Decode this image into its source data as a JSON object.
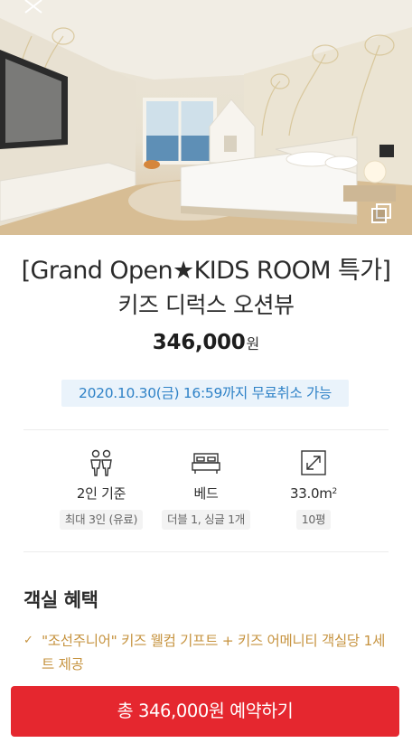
{
  "hero": {
    "image_alt": "",
    "close_icon": "close-icon",
    "gallery_icon": "gallery-icon"
  },
  "room": {
    "title": "[Grand Open★KIDS ROOM 특가]",
    "name": "키즈 디럭스 오션뷰",
    "price_amount": "346,000",
    "price_unit": "원",
    "cancel_notice": "2020.10.30(금) 16:59까지 무료취소 가능"
  },
  "specs": [
    {
      "icon": "guests-icon",
      "label": "2인 기준",
      "detail": "최대 3인 (유료)"
    },
    {
      "icon": "bed-icon",
      "label": "베드",
      "detail": "더블 1, 싱글 1개"
    },
    {
      "icon": "room-size-icon",
      "label": "33.0m",
      "label_sup": "2",
      "detail": "10평"
    }
  ],
  "benefits": {
    "title": "객실 혜택",
    "items": [
      "\"조선주니어\" 키즈 웰컴 기프트 + 키즈 어메니티 객실당 1세트 제공"
    ]
  },
  "cta": {
    "label": "총 346,000원 예약하기"
  },
  "colors": {
    "accent": "#e5272f",
    "link_blue": "#2f82c7",
    "benefit_gold": "#c6933f"
  }
}
